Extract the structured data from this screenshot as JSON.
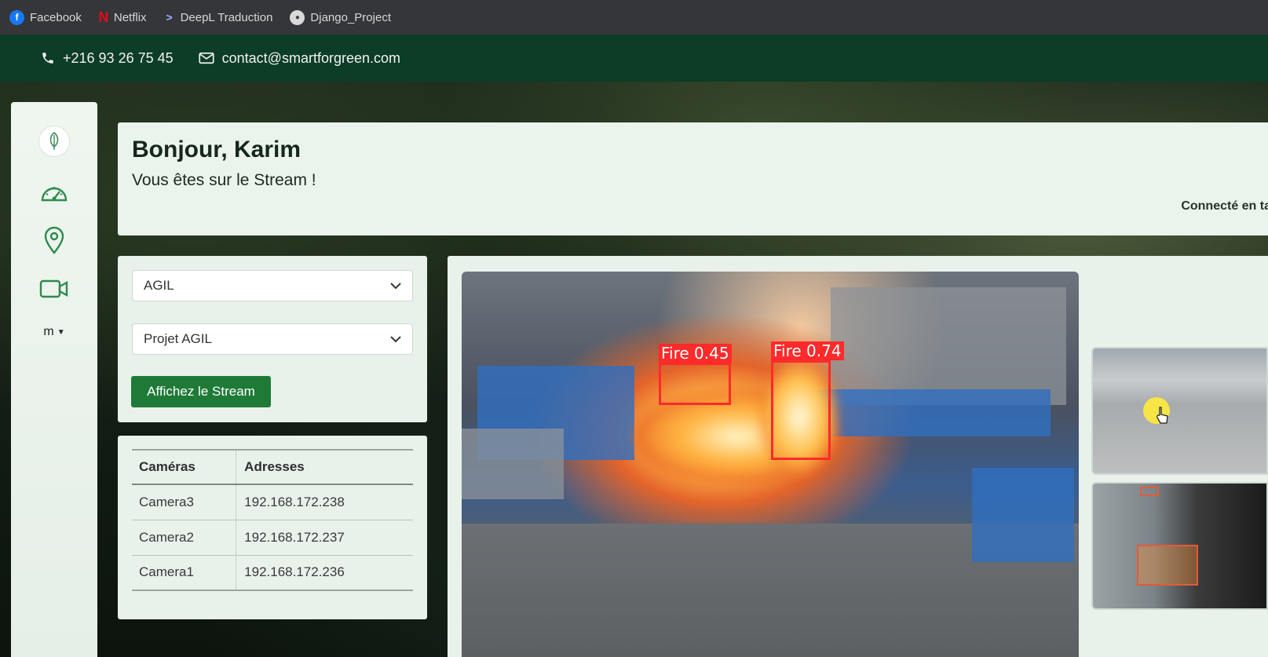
{
  "bookmarks": [
    {
      "label": "Facebook",
      "icon": "facebook-icon"
    },
    {
      "label": "Netflix",
      "icon": "netflix-icon"
    },
    {
      "label": "DeepL Traduction",
      "icon": "deepl-icon"
    },
    {
      "label": "Django_Project",
      "icon": "django-icon"
    }
  ],
  "contact": {
    "phone": "+216 93 26 75 45",
    "email": "contact@smartforgreen.com"
  },
  "sidebar": {
    "items": [
      {
        "name": "logo",
        "icon": "leaf-logo-icon"
      },
      {
        "name": "dashboard",
        "icon": "speedometer-icon"
      },
      {
        "name": "map",
        "icon": "location-pin-icon"
      },
      {
        "name": "stream",
        "icon": "video-camera-icon"
      }
    ],
    "user_alt": "m"
  },
  "greeting": {
    "title": "Bonjour, Karim",
    "subtitle": "Vous êtes sur le Stream !",
    "status": "Connecté en ta"
  },
  "selection": {
    "company": "AGIL",
    "project": "Projet AGIL",
    "button": "Affichez le Stream"
  },
  "cameras": {
    "headers": [
      "Caméras",
      "Adresses"
    ],
    "rows": [
      [
        "Camera3",
        "192.168.172.238"
      ],
      [
        "Camera2",
        "192.168.172.237"
      ],
      [
        "Camera1",
        "192.168.172.236"
      ]
    ]
  },
  "stream": {
    "detections": [
      {
        "label": "Fire 0.45",
        "confidence": 0.45
      },
      {
        "label": "Fire 0.74",
        "confidence": 0.74
      }
    ]
  },
  "colors": {
    "brand_dark": "#0c3d26",
    "accent_green": "#1f7a38",
    "detection_red": "#ff2a2a"
  }
}
